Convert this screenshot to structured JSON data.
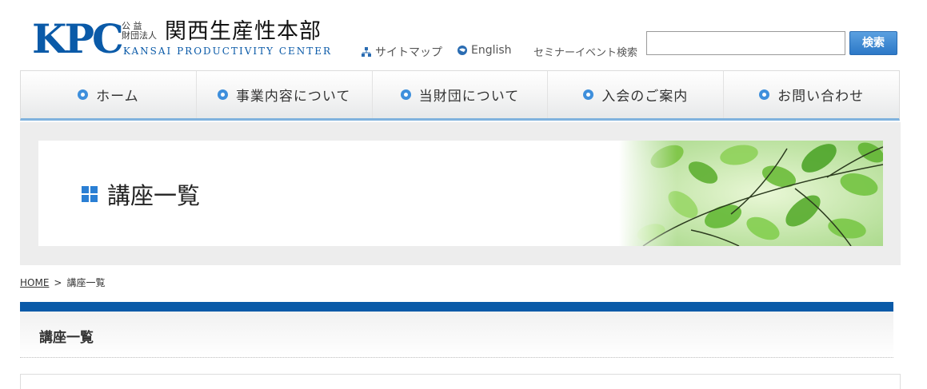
{
  "header": {
    "logo_mark": "KPC",
    "logo_small_top": "公 益",
    "logo_small_bottom": "財団法人",
    "logo_name": "関西生産性本部",
    "logo_english": "KANSAI PRODUCTIVITY CENTER",
    "links": {
      "sitemap": "サイトマップ",
      "english": "English",
      "seminar_search": "セミナーイベント検索"
    },
    "search": {
      "value": "",
      "placeholder": "",
      "button_label": "検索"
    }
  },
  "nav": {
    "items": [
      {
        "label": "ホーム"
      },
      {
        "label": "事業内容について"
      },
      {
        "label": "当財団について"
      },
      {
        "label": "入会のご案内"
      },
      {
        "label": "お問い合わせ"
      }
    ]
  },
  "banner": {
    "title": "講座一覧"
  },
  "breadcrumb": {
    "home": "HOME",
    "separator": ">",
    "current": "講座一覧"
  },
  "section": {
    "title": "講座一覧"
  },
  "colors": {
    "brand_blue": "#0a5aa8",
    "accent_blue": "#3e8fdc",
    "leaf_green": "#7cc543"
  },
  "icons": {
    "sitemap": "sitemap-icon",
    "english": "globe-icon",
    "nav_bullet": "circle-bullet-icon",
    "title": "grid-squares-icon"
  }
}
